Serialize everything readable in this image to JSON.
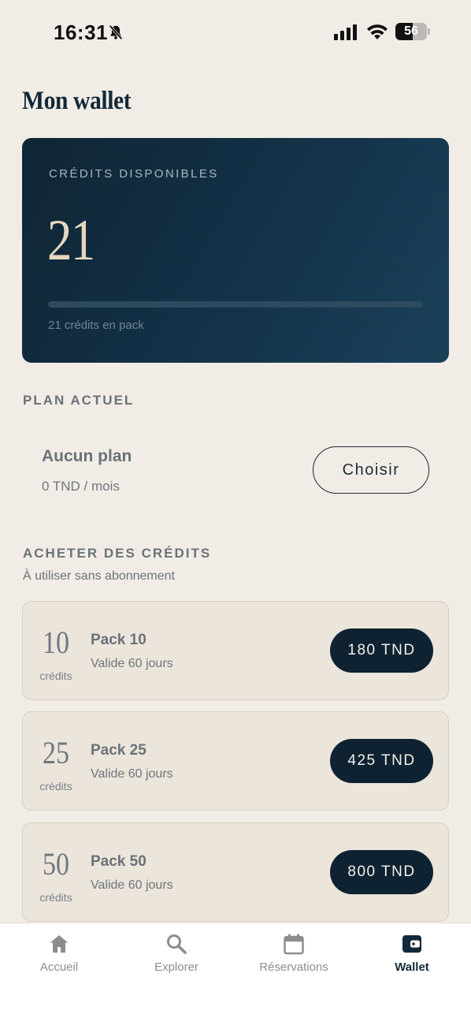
{
  "status_bar": {
    "time": "16:31",
    "battery": "56",
    "battery_level": 0.56
  },
  "page_title": "Mon wallet",
  "credit_card": {
    "label": "CRÉDITS DISPONIBLES",
    "value": "21",
    "caption": "21 crédits en pack"
  },
  "current_plan": {
    "heading": "PLAN ACTUEL",
    "name": "Aucun plan",
    "price": "0 TND / mois",
    "choose_label": "Choisir"
  },
  "buy_credits": {
    "heading": "ACHETER DES CRÉDITS",
    "subtitle": "À utiliser sans abonnement",
    "packs": [
      {
        "credits": "10",
        "unit": "crédits",
        "name": "Pack 10",
        "validity": "Valide 60 jours",
        "price": "180 TND"
      },
      {
        "credits": "25",
        "unit": "crédits",
        "name": "Pack 25",
        "validity": "Valide 60 jours",
        "price": "425 TND"
      },
      {
        "credits": "50",
        "unit": "crédits",
        "name": "Pack 50",
        "validity": "Valide 60 jours",
        "price": "800 TND"
      }
    ]
  },
  "bottom_nav": {
    "items": [
      {
        "label": "Accueil",
        "icon": "home-icon"
      },
      {
        "label": "Explorer",
        "icon": "search-icon"
      },
      {
        "label": "Réservations",
        "icon": "calendar-icon"
      },
      {
        "label": "Wallet",
        "icon": "wallet-icon",
        "active": true
      }
    ]
  },
  "colors": {
    "background": "#f1ede6",
    "card_dark": "#143249",
    "accent_gold": "#e6d7bf",
    "button_dark": "#0e2232"
  }
}
